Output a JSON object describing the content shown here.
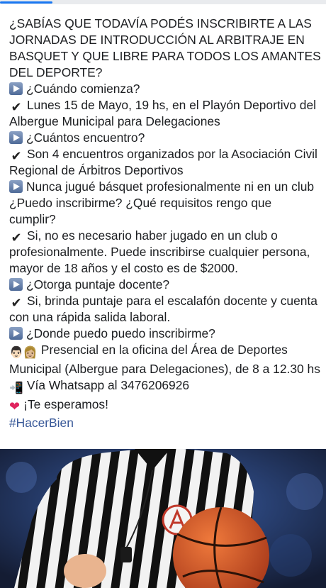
{
  "progress": {
    "fraction": 0.16
  },
  "post": {
    "intro": "¿SABÍAS QUE TODAVÍA PODÉS INSCRIBIRTE A LAS JORNADAS DE INTRODUCCIÓN AL ARBITRAJE EN BASQUET Y QUE LIBRE PARA TODOS LOS AMANTES DEL DEPORTE?",
    "q1": "¿Cuándo comienza?",
    "a1": "Lunes 15 de Mayo, 19 hs, en el Playón Deportivo del Albergue Municipal para Delegaciones",
    "q2": "¿Cuántos encuentro?",
    "a2": "Son 4 encuentros organizados por la Asociación Civil Regional de Árbitros Deportivos",
    "q3": "Nunca jugué básquet profesionalmente ni en un club ¿Puedo inscribirme? ¿Qué requisitos rengo que cumplir?",
    "a3": "Si, no es necesario haber jugado en un club o profesionalmente. Puede inscribirse cualquier persona, mayor de 18 años y el costo es de $2000.",
    "q4": "¿Otorga puntaje docente?",
    "a4": "Si, brinda puntaje para el escalafón docente y cuenta con una rápida salida laboral.",
    "q5": "¿Donde puedo puedo inscribirme?",
    "a5": "Presencial en la oficina del Área de Deportes Municipal (Albergue para Delegaciones), de 8 a 12.30 hs",
    "whatsapp": "Vía Whatsapp al 3476206926",
    "closing": "¡Te esperamos!",
    "hashtag": "#HacerBien"
  },
  "icons": {
    "question": "play-button-icon",
    "answer": "check-mark-icon",
    "location": "people-icon",
    "phone": "mobile-phone-icon",
    "closing": "heart-icon"
  },
  "colors": {
    "link": "#385898",
    "progress": "#1877f2",
    "heart": "#e0245e"
  }
}
